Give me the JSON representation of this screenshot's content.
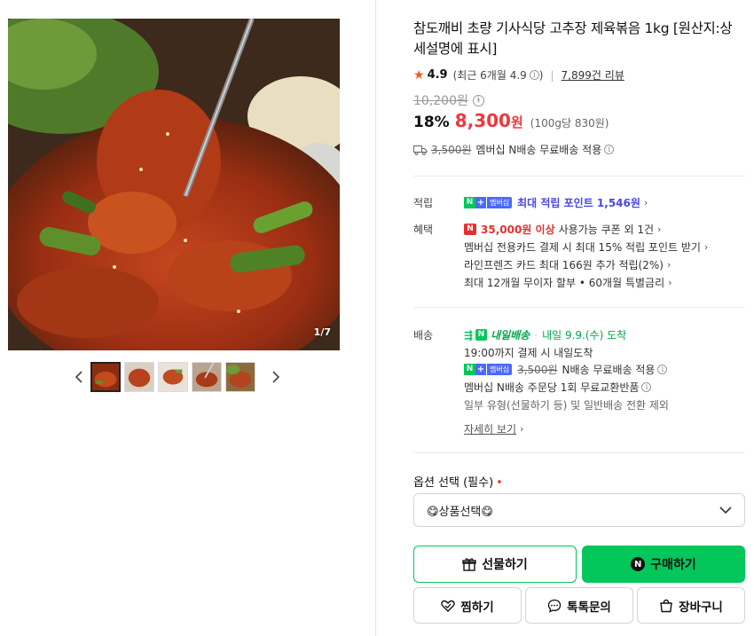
{
  "gallery": {
    "counter": "1/7",
    "thumb_count": 5
  },
  "product": {
    "title": "참도깨비 초량 기사식당 고추장 제육볶음 1kg [원산지:상세설명에 표시]",
    "rating_score": "4.9",
    "rating_recent": "(최근 6개월 4.9",
    "rating_recent_close": ")",
    "review_count": "7,899건 리뷰",
    "original_price": "10,200원",
    "discount": "18%",
    "sale_price": "8,300",
    "sale_unit": "원",
    "unit_price": "(100g당 830원)",
    "shipping_strike": "3,500원",
    "shipping_text": "멤버십 N배송 무료배송 적용"
  },
  "accrual": {
    "label": "적립",
    "badge_mem": "멤버십",
    "text": "최대 적립 포인트 1,546원"
  },
  "benefit": {
    "label": "혜택",
    "coupon_amount": "35,000원 이상",
    "coupon_text": "사용가능 쿠폰 외 1건",
    "line2": "멤버십 전용카드 결제 시 최대 15% 적립 포인트 받기",
    "line3": "라인프렌즈 카드 최대 166원 추가 적립(2%)",
    "line4": "최대 12개월 무이자 할부 • 60개월 특별금리"
  },
  "delivery": {
    "label": "배송",
    "tomorrow": "내일배송",
    "arrival": "내일 9.9.(수) 도착",
    "cutoff": "19:00까지 결제 시 내일도착",
    "badge_mem": "멤버십",
    "fee_strike": "3,500원",
    "fee_text": "N배송 무료배송 적용",
    "returns": "멤버십 N배송 주문당 1회 무료교환반품",
    "exclude": "일부 유형(선물하기 등) 및 일반배송 전환 제외",
    "more": "자세히 보기"
  },
  "options": {
    "label": "옵션 선택 (필수)",
    "required_mark": "•",
    "select_value": "😋상품선택😋"
  },
  "buttons": {
    "gift": "선물하기",
    "buy": "구매하기",
    "wish": "찜하기",
    "talk": "톡톡문의",
    "cart": "장바구니"
  },
  "colors": {
    "accent_green": "#03c75a",
    "price_red": "#f0363d",
    "point_blue": "#4b46e6",
    "star": "#f35a1a"
  }
}
